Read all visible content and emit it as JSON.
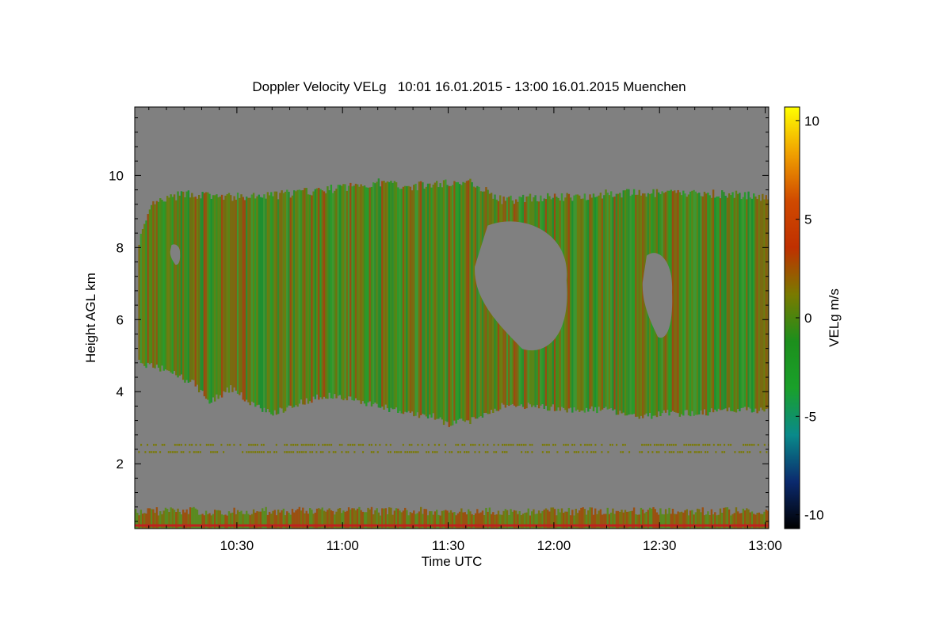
{
  "chart_data": {
    "type": "heatmap",
    "title": "Doppler Velocity VELg   10:01 16.01.2015 - 13:00 16.01.2015 Muenchen",
    "xlabel": "Time UTC",
    "ylabel": "Height AGL km",
    "colorbar_label": "VELg m/s",
    "x_range_utc": [
      "10:01",
      "13:00"
    ],
    "x_ticks": [
      {
        "label": "10:30",
        "minutes": 630
      },
      {
        "label": "11:00",
        "minutes": 660
      },
      {
        "label": "11:30",
        "minutes": 690
      },
      {
        "label": "12:00",
        "minutes": 720
      },
      {
        "label": "12:30",
        "minutes": 750
      },
      {
        "label": "13:00",
        "minutes": 780
      }
    ],
    "x_min_minutes": 601,
    "x_max_minutes": 781,
    "ylim": [
      0.2,
      11.9
    ],
    "y_ticks": [
      {
        "label": "2",
        "value": 2
      },
      {
        "label": "4",
        "value": 4
      },
      {
        "label": "6",
        "value": 6
      },
      {
        "label": "8",
        "value": 8
      },
      {
        "label": "10",
        "value": 10
      }
    ],
    "colorbar": {
      "range": [
        -10.7,
        10.7
      ],
      "ticks": [
        {
          "label": "10",
          "value": 10
        },
        {
          "label": "5",
          "value": 5
        },
        {
          "label": "0",
          "value": 0
        },
        {
          "label": "-5",
          "value": -5
        },
        {
          "label": "-10",
          "value": -10
        }
      ],
      "colormap": [
        "#000000",
        "#0b2a6e",
        "#0a8a8a",
        "#1aa02a",
        "#1c8f1c",
        "#7a7a00",
        "#c03000",
        "#d04a00",
        "#f0a000",
        "#ffff00"
      ]
    },
    "background_color": "#808080",
    "cloud_layer": {
      "description_values_ms": "mostly -3 to +2 m/s",
      "top_km": [
        [
          602,
          8.2
        ],
        [
          606,
          9.2
        ],
        [
          615,
          9.5
        ],
        [
          625,
          9.4
        ],
        [
          635,
          9.4
        ],
        [
          645,
          9.5
        ],
        [
          655,
          9.6
        ],
        [
          662,
          9.7
        ],
        [
          670,
          9.8
        ],
        [
          680,
          9.7
        ],
        [
          690,
          9.8
        ],
        [
          697,
          9.8
        ],
        [
          705,
          9.3
        ],
        [
          715,
          9.4
        ],
        [
          725,
          9.4
        ],
        [
          735,
          9.5
        ],
        [
          745,
          9.5
        ],
        [
          755,
          9.5
        ],
        [
          765,
          9.5
        ],
        [
          780,
          9.4
        ]
      ],
      "base_km": [
        [
          602,
          4.8
        ],
        [
          610,
          4.6
        ],
        [
          618,
          4.2
        ],
        [
          622,
          3.7
        ],
        [
          628,
          4.1
        ],
        [
          635,
          3.6
        ],
        [
          640,
          3.4
        ],
        [
          648,
          3.7
        ],
        [
          655,
          3.9
        ],
        [
          662,
          3.8
        ],
        [
          670,
          3.6
        ],
        [
          678,
          3.4
        ],
        [
          686,
          3.3
        ],
        [
          690,
          3.1
        ],
        [
          696,
          3.2
        ],
        [
          705,
          3.6
        ],
        [
          715,
          3.6
        ],
        [
          725,
          3.5
        ],
        [
          735,
          3.5
        ],
        [
          745,
          3.3
        ],
        [
          752,
          3.4
        ],
        [
          760,
          3.4
        ],
        [
          770,
          3.5
        ],
        [
          780,
          3.5
        ]
      ],
      "gaps": [
        {
          "t0": 697,
          "t1": 725,
          "h0": 5.0,
          "h1": 8.8
        },
        {
          "t0": 745,
          "t1": 754,
          "h0": 5.4,
          "h1": 7.9
        },
        {
          "t0": 611,
          "t1": 614,
          "h0": 7.5,
          "h1": 8.1
        }
      ]
    },
    "residual_layers_km": [
      {
        "height": 2.35,
        "color": "#7a7a00"
      },
      {
        "height": 2.55,
        "color": "#7a7a00"
      }
    ],
    "surface_layer_km": [
      0.2,
      0.8
    ]
  }
}
